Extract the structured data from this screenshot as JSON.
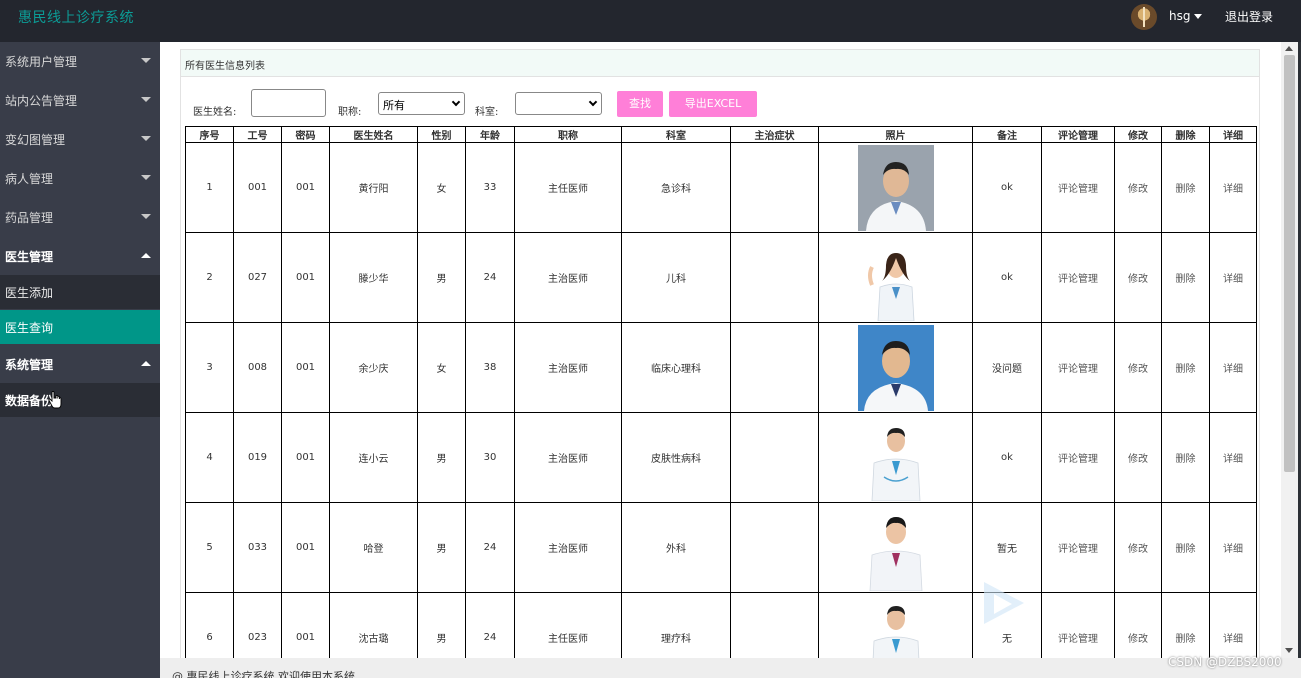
{
  "app": {
    "title": "惠民线上诊疗系统",
    "user": "hsg",
    "logout": "退出登录"
  },
  "sidebar": {
    "items": [
      {
        "label": "系统用户管理"
      },
      {
        "label": "站内公告管理"
      },
      {
        "label": "变幻图管理"
      },
      {
        "label": "病人管理"
      },
      {
        "label": "药品管理"
      },
      {
        "label": "医生管理"
      },
      {
        "label": "系统管理"
      }
    ],
    "doctor_sub": [
      {
        "label": "医生添加"
      },
      {
        "label": "医生查询"
      }
    ],
    "system_sub": [
      {
        "label": "数据备份"
      }
    ]
  },
  "panel": {
    "title": "所有医生信息列表"
  },
  "search": {
    "name_label": "医生姓名:",
    "name_value": "",
    "title_label": "职称:",
    "title_value": "所有",
    "dept_label": "科室:",
    "dept_value": "",
    "search_btn": "查找",
    "export_btn": "导出EXCEL"
  },
  "table": {
    "headers": [
      "序号",
      "工号",
      "密码",
      "医生姓名",
      "性别",
      "年龄",
      "职称",
      "科室",
      "主治症状",
      "照片",
      "备注",
      "评论管理",
      "修改",
      "删除",
      "详细"
    ],
    "rows": [
      {
        "no": "1",
        "id": "001",
        "pwd": "001",
        "name": "黄行阳",
        "gender": "女",
        "age": "33",
        "title": "主任医师",
        "dept": "急诊科",
        "symptom": "",
        "note": "ok",
        "comment": "评论管理",
        "edit": "修改",
        "del": "删除",
        "detail": "详细"
      },
      {
        "no": "2",
        "id": "027",
        "pwd": "001",
        "name": "滕少华",
        "gender": "男",
        "age": "24",
        "title": "主治医师",
        "dept": "儿科",
        "symptom": "",
        "note": "ok",
        "comment": "评论管理",
        "edit": "修改",
        "del": "删除",
        "detail": "详细"
      },
      {
        "no": "3",
        "id": "008",
        "pwd": "001",
        "name": "余少庆",
        "gender": "女",
        "age": "38",
        "title": "主治医师",
        "dept": "临床心理科",
        "symptom": "",
        "note": "没问题",
        "comment": "评论管理",
        "edit": "修改",
        "del": "删除",
        "detail": "详细"
      },
      {
        "no": "4",
        "id": "019",
        "pwd": "001",
        "name": "连小云",
        "gender": "男",
        "age": "30",
        "title": "主治医师",
        "dept": "皮肤性病科",
        "symptom": "",
        "note": "ok",
        "comment": "评论管理",
        "edit": "修改",
        "del": "删除",
        "detail": "详细"
      },
      {
        "no": "5",
        "id": "033",
        "pwd": "001",
        "name": "哈登",
        "gender": "男",
        "age": "24",
        "title": "主治医师",
        "dept": "外科",
        "symptom": "",
        "note": "暂无",
        "comment": "评论管理",
        "edit": "修改",
        "del": "删除",
        "detail": "详细"
      },
      {
        "no": "6",
        "id": "023",
        "pwd": "001",
        "name": "沈古璐",
        "gender": "男",
        "age": "24",
        "title": "主任医师",
        "dept": "理疗科",
        "symptom": "",
        "note": "无",
        "comment": "评论管理",
        "edit": "修改",
        "del": "删除",
        "detail": "详细"
      }
    ]
  },
  "footer": {
    "text": "@ 惠民线上诊疗系统 欢迎使用本系统"
  },
  "watermark": "CSDN @DZBS2000",
  "colors": {
    "accent": "#009688",
    "title_teal": "#0c9c96",
    "button_pink": "#ff7fd8",
    "sidebar_bg": "#393d49",
    "topbar_bg": "#23262e"
  }
}
